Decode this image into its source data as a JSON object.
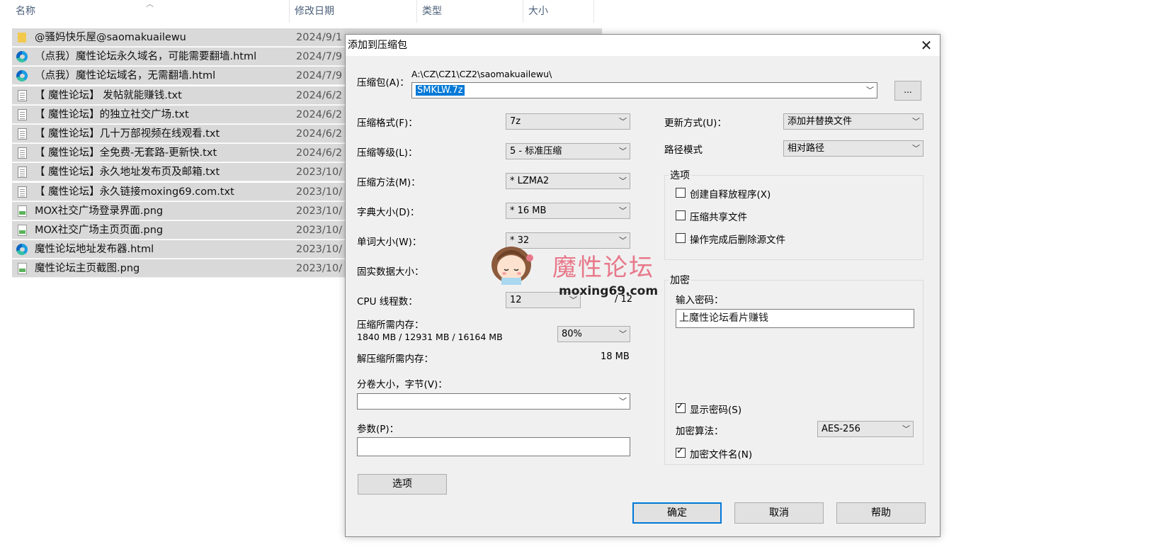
{
  "explorer": {
    "columns": {
      "name": "名称",
      "modified": "修改日期",
      "type": "类型",
      "size": "大小"
    },
    "files": [
      {
        "name": "@骚妈快乐屋@saomakuailewu",
        "date": "2024/9/1",
        "icon": "folder"
      },
      {
        "name": "（点我）魔性论坛永久域名，可能需要翻墙.html",
        "date": "2024/7/9",
        "icon": "edge"
      },
      {
        "name": "（点我）魔性论坛域名，无需翻墙.html",
        "date": "2024/7/9",
        "icon": "edge"
      },
      {
        "name": "【 魔性论坛】 发帖就能赚钱.txt",
        "date": "2024/6/2",
        "icon": "txt"
      },
      {
        "name": "【 魔性论坛】的独立社交广场.txt",
        "date": "2024/6/2",
        "icon": "txt"
      },
      {
        "name": "【 魔性论坛】几十万部视频在线观看.txt",
        "date": "2024/6/2",
        "icon": "txt"
      },
      {
        "name": "【 魔性论坛】全免费-无套路-更新快.txt",
        "date": "2024/6/2",
        "icon": "txt"
      },
      {
        "name": "【 魔性论坛】永久地址发布页及邮箱.txt",
        "date": "2023/10/",
        "icon": "txt"
      },
      {
        "name": "【 魔性论坛】永久链接moxing69.com.txt",
        "date": "2023/10/",
        "icon": "txt"
      },
      {
        "name": "MOX社交广场登录界面.png",
        "date": "2023/10/",
        "icon": "png"
      },
      {
        "name": "MOX社交广场主页页面.png",
        "date": "2023/10/",
        "icon": "png"
      },
      {
        "name": "魔性论坛地址发布器.html",
        "date": "2023/10/",
        "icon": "edge"
      },
      {
        "name": "魔性论坛主页截图.png",
        "date": "2023/10/",
        "icon": "png"
      }
    ]
  },
  "dialog": {
    "title": "添加到压缩包",
    "close": "✕",
    "archive": {
      "label": "压缩包(A)：",
      "path": "A:\\CZ\\CZ1\\CZ2\\saomakuailewu\\",
      "value": "SMKLW.7z",
      "browse": "..."
    },
    "format": {
      "label": "压缩格式(F)：",
      "value": "7z"
    },
    "level": {
      "label": "压缩等级(L)：",
      "value": "5 - 标准压缩"
    },
    "method": {
      "label": "压缩方法(M)：",
      "value": "* LZMA2"
    },
    "dict": {
      "label": "字典大小(D)：",
      "value": "* 16 MB"
    },
    "word": {
      "label": "单词大小(W)：",
      "value": "* 32"
    },
    "solid": {
      "label": "固实数据大小："
    },
    "threads": {
      "label": "CPU 线程数：",
      "value": "12",
      "total": "/ 12"
    },
    "mem_compress": {
      "label": "压缩所需内存：",
      "detail": "1840 MB / 12931 MB / 16164 MB",
      "percent": "80%"
    },
    "mem_decompress": {
      "label": "解压缩所需内存：",
      "value": "18 MB"
    },
    "volume": {
      "label": "分卷大小，字节(V)：",
      "value": ""
    },
    "params": {
      "label": "参数(P)：",
      "value": ""
    },
    "options_btn": "选项",
    "update": {
      "label": "更新方式(U)：",
      "value": "添加并替换文件"
    },
    "pathmode": {
      "label": "路径模式",
      "value": "相对路径"
    },
    "options": {
      "title": "选项",
      "items": [
        {
          "label": "创建自释放程序(X)",
          "checked": false
        },
        {
          "label": "压缩共享文件",
          "checked": false
        },
        {
          "label": "操作完成后删除源文件",
          "checked": false
        }
      ]
    },
    "encryption": {
      "title": "加密",
      "password_label": "输入密码：",
      "password": "上魔性论坛看片赚钱",
      "show_password": "显示密码(S)",
      "method_label": "加密算法：",
      "method": "AES-256",
      "encrypt_names": "加密文件名(N)"
    },
    "buttons": {
      "ok": "确定",
      "cancel": "取消",
      "help": "帮助"
    }
  },
  "watermark": {
    "title": "魔性论坛",
    "url": "moxing69.com"
  }
}
